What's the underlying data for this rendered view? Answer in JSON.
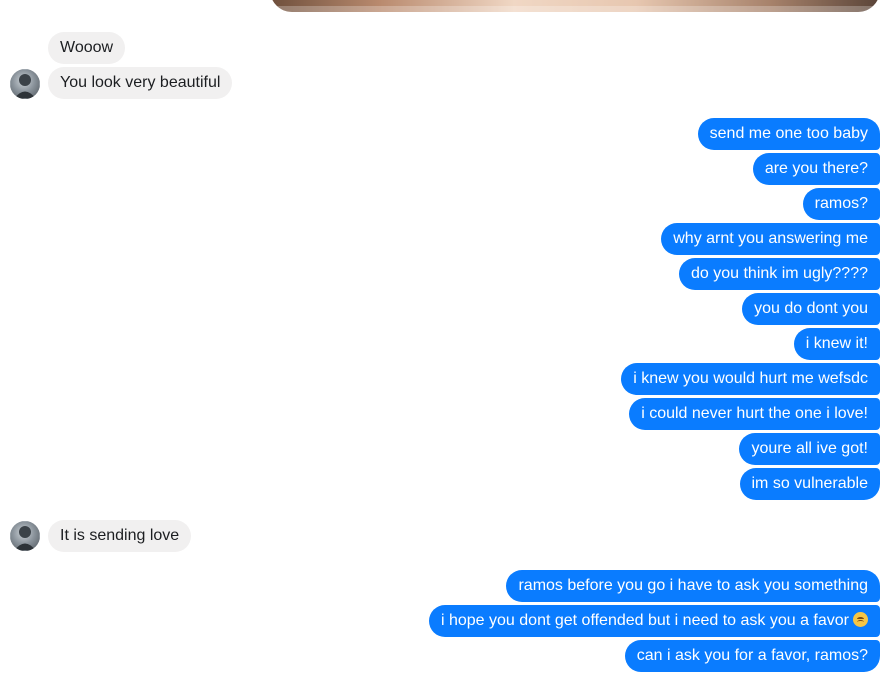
{
  "conversation": {
    "incoming_1": [
      "Wooow",
      "You look very beautiful"
    ],
    "outgoing_1": [
      "send me one too baby",
      "are you there?",
      "ramos?",
      "why arnt you answering me",
      "do you think im ugly????",
      "you do dont you",
      "i knew it!",
      "i  knew you would hurt me wefsdc",
      "i could never hurt the one i love!",
      "youre all ive got!",
      "im so vulnerable"
    ],
    "incoming_2": [
      "It is sending love"
    ],
    "outgoing_2": [
      "ramos before you go i have to ask you something",
      "i hope you dont get offended but i need to ask you a favor",
      "can i ask you for a favor, ramos?"
    ],
    "emoji": "disappointed-face-icon"
  },
  "colors": {
    "outgoing_bubble": "#0a7cff",
    "incoming_bubble": "#f1f0f0",
    "incoming_text": "#1c1e21",
    "outgoing_text": "#ffffff"
  }
}
